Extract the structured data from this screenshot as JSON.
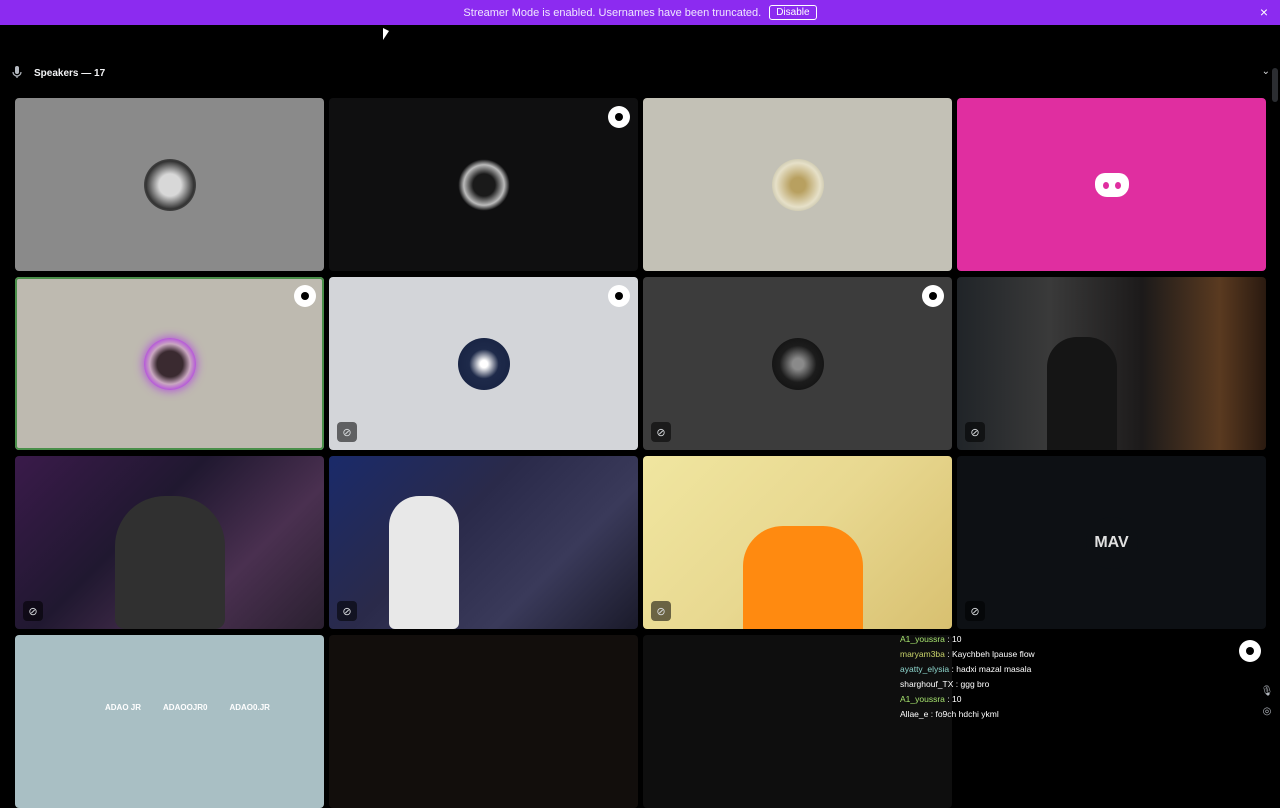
{
  "banner": {
    "message": "Streamer Mode is enabled. Usernames have been truncated.",
    "button_label": "Disable",
    "close_symbol": "×",
    "color": "#8c2bf0"
  },
  "section": {
    "title": "Speakers — 17",
    "icon": "microphone-icon",
    "collapse_symbol": "⌄"
  },
  "overlays": {
    "socials": [
      {
        "icon": "youtube-icon",
        "handle": "ADAO JR"
      },
      {
        "icon": "kick-icon",
        "handle": "ADAOOJR0"
      },
      {
        "icon": "instagram-icon",
        "handle": "ADAO0.JR"
      }
    ],
    "mav_logo": "MAV"
  },
  "chat": [
    {
      "name": "A1_youssra",
      "text": ": 10",
      "color": "green"
    },
    {
      "name": "maryam3ba",
      "text": ": Kaychbeh lpause flow",
      "color": "yellow"
    },
    {
      "name": "ayatty_elysia",
      "text": ": hadxi mazal masala",
      "color": "teal"
    },
    {
      "name": "sharghouf_TX",
      "text": ": ggg bro",
      "color": "white"
    },
    {
      "name": "A1_youssra",
      "text": ": 10",
      "color": "green"
    },
    {
      "name": "Allae_e",
      "text": ": fo9ch hdchi ykml",
      "color": "white"
    }
  ],
  "icons": {
    "muted": "⊘",
    "mic_right": "🎙",
    "target_right": "◎"
  }
}
